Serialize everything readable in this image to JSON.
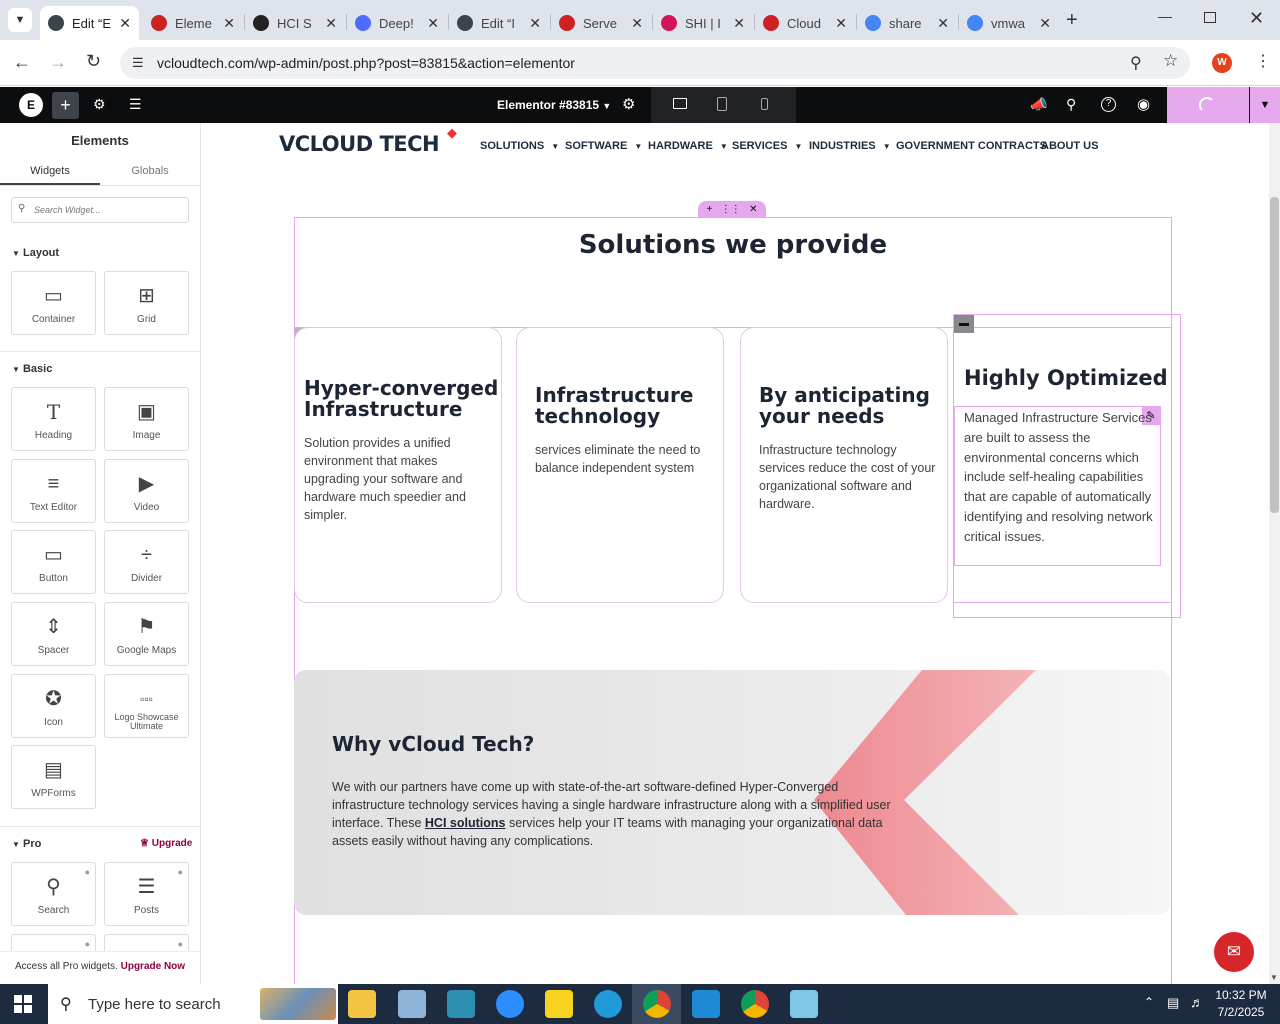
{
  "browser": {
    "tabs": [
      {
        "label": "Edit “E",
        "icon": "wordpress-icon",
        "color": "#3c434a",
        "active": true
      },
      {
        "label": "Eleme",
        "icon": "elementor-diamond-icon",
        "color": "#c22"
      },
      {
        "label": "HCI S",
        "icon": "globe-icon",
        "color": "#222"
      },
      {
        "label": "Deep!",
        "icon": "deepseek-icon",
        "color": "#4d6bfe"
      },
      {
        "label": "Edit “I",
        "icon": "wordpress-icon",
        "color": "#3c434a"
      },
      {
        "label": "Serve",
        "icon": "elementor-diamond-icon",
        "color": "#c22"
      },
      {
        "label": "SHI | I",
        "icon": "shi-ring-icon",
        "color": "#d4145a"
      },
      {
        "label": "Cloud",
        "icon": "cloud-swoosh-icon",
        "color": "#c22"
      },
      {
        "label": "share",
        "icon": "google-icon",
        "color": "#4285f4"
      },
      {
        "label": "vmwa",
        "icon": "google-icon",
        "color": "#4285f4"
      }
    ],
    "url": "vcloudtech.com/wp-admin/post.php?post=83815&action=elementor",
    "profile_initial": "W"
  },
  "elementor": {
    "doc_title": "Elementor #83815",
    "panel_title": "Elements",
    "tab_widgets": "Widgets",
    "tab_globals": "Globals",
    "search_placeholder": "Search Widget...",
    "sections": {
      "layout": "Layout",
      "basic": "Basic",
      "pro": "Pro",
      "upgrade": "Upgrade"
    },
    "layout_widgets": [
      "Container",
      "Grid"
    ],
    "basic_widgets": [
      "Heading",
      "Image",
      "Text Editor",
      "Video",
      "Button",
      "Divider",
      "Spacer",
      "Google Maps",
      "Icon",
      "Logo Showcase Ultimate",
      "WPForms"
    ],
    "pro_widgets": [
      "Search",
      "Posts"
    ],
    "footer_text": "Access all Pro widgets.",
    "footer_link": "Upgrade Now"
  },
  "site": {
    "logo_text": "VCLOUD TECH",
    "nav": [
      "SOLUTIONS",
      "SOFTWARE",
      "HARDWARE",
      "SERVICES",
      "INDUSTRIES",
      "GOVERNMENT CONTRACTS",
      "ABOUT US"
    ],
    "section_title": "Solutions we provide",
    "cards": [
      {
        "title": "Hyper-converged Infrastructure",
        "text": "Solution provides a unified environment that makes upgrading your software and hardware much speedier and simpler."
      },
      {
        "title": "Infrastructure technology",
        "text": "services eliminate the need to balance independent system"
      },
      {
        "title": "By anticipating your needs",
        "text": "Infrastructure technology services reduce the cost of your organizational software and hardware."
      },
      {
        "title": "Highly Optimized",
        "text": "Managed Infrastructure Services are built to assess the environmental concerns which include self-healing capabilities that are capable of automatically identifying and resolving network critical issues."
      }
    ],
    "why_title": "Why vCloud Tech?",
    "why_text_before": "We with our partners have come up with state-of-the-art software-defined Hyper-Converged infrastructure technology services having a single hardware infrastructure along with a simplified user interface. These",
    "why_link": "HCI solutions",
    "why_text_after": "services help your IT teams with managing your organizational data assets easily without having any complications."
  },
  "taskbar": {
    "search_placeholder": "Type here to search",
    "time": "10:32 PM",
    "date": "7/2/2025"
  },
  "colors": {
    "accent": "#e5a8ec",
    "elementor_dark": "#0c0d0e",
    "brand_red": "#e33",
    "chat": "#d6262a"
  }
}
